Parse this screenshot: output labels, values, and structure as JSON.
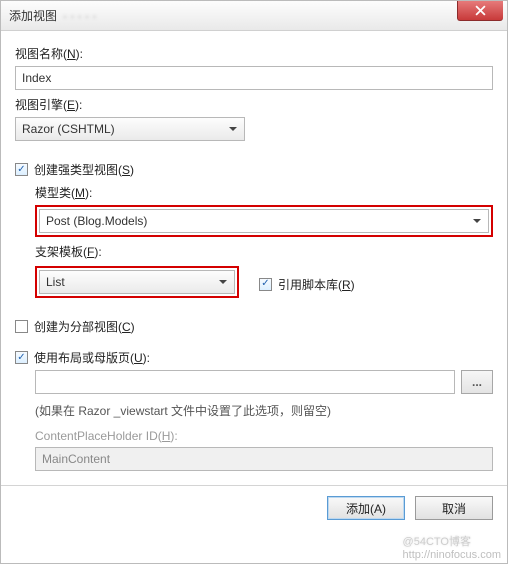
{
  "titlebar": {
    "title": "添加视图",
    "blurred_hint": "· · · · ·"
  },
  "labels": {
    "view_name": "视图名称(N):",
    "view_engine": "视图引擎(E):",
    "strongly_typed": "创建强类型视图(S)",
    "model_class": "模型类(M):",
    "scaffold": "支架模板(F):",
    "reference_scripts": "引用脚本库(R)",
    "partial_view": "创建为分部视图(C)",
    "use_layout": "使用布局或母版页(U):",
    "layout_hint": "(如果在 Razor _viewstart 文件中设置了此选项，则留空)",
    "content_placeholder": "ContentPlaceHolder ID(H):",
    "browse": "..."
  },
  "values": {
    "view_name": "Index",
    "view_engine": "Razor (CSHTML)",
    "model_class": "Post (Blog.Models)",
    "scaffold": "List",
    "layout_path": "",
    "content_placeholder": "MainContent"
  },
  "checkboxes": {
    "strongly_typed": true,
    "reference_scripts": true,
    "partial_view": false,
    "use_layout": true
  },
  "buttons": {
    "ok": "添加(A)",
    "cancel": "取消"
  },
  "watermark": {
    "logo": "@54CTO博客",
    "url": "http://ninofocus.com"
  }
}
